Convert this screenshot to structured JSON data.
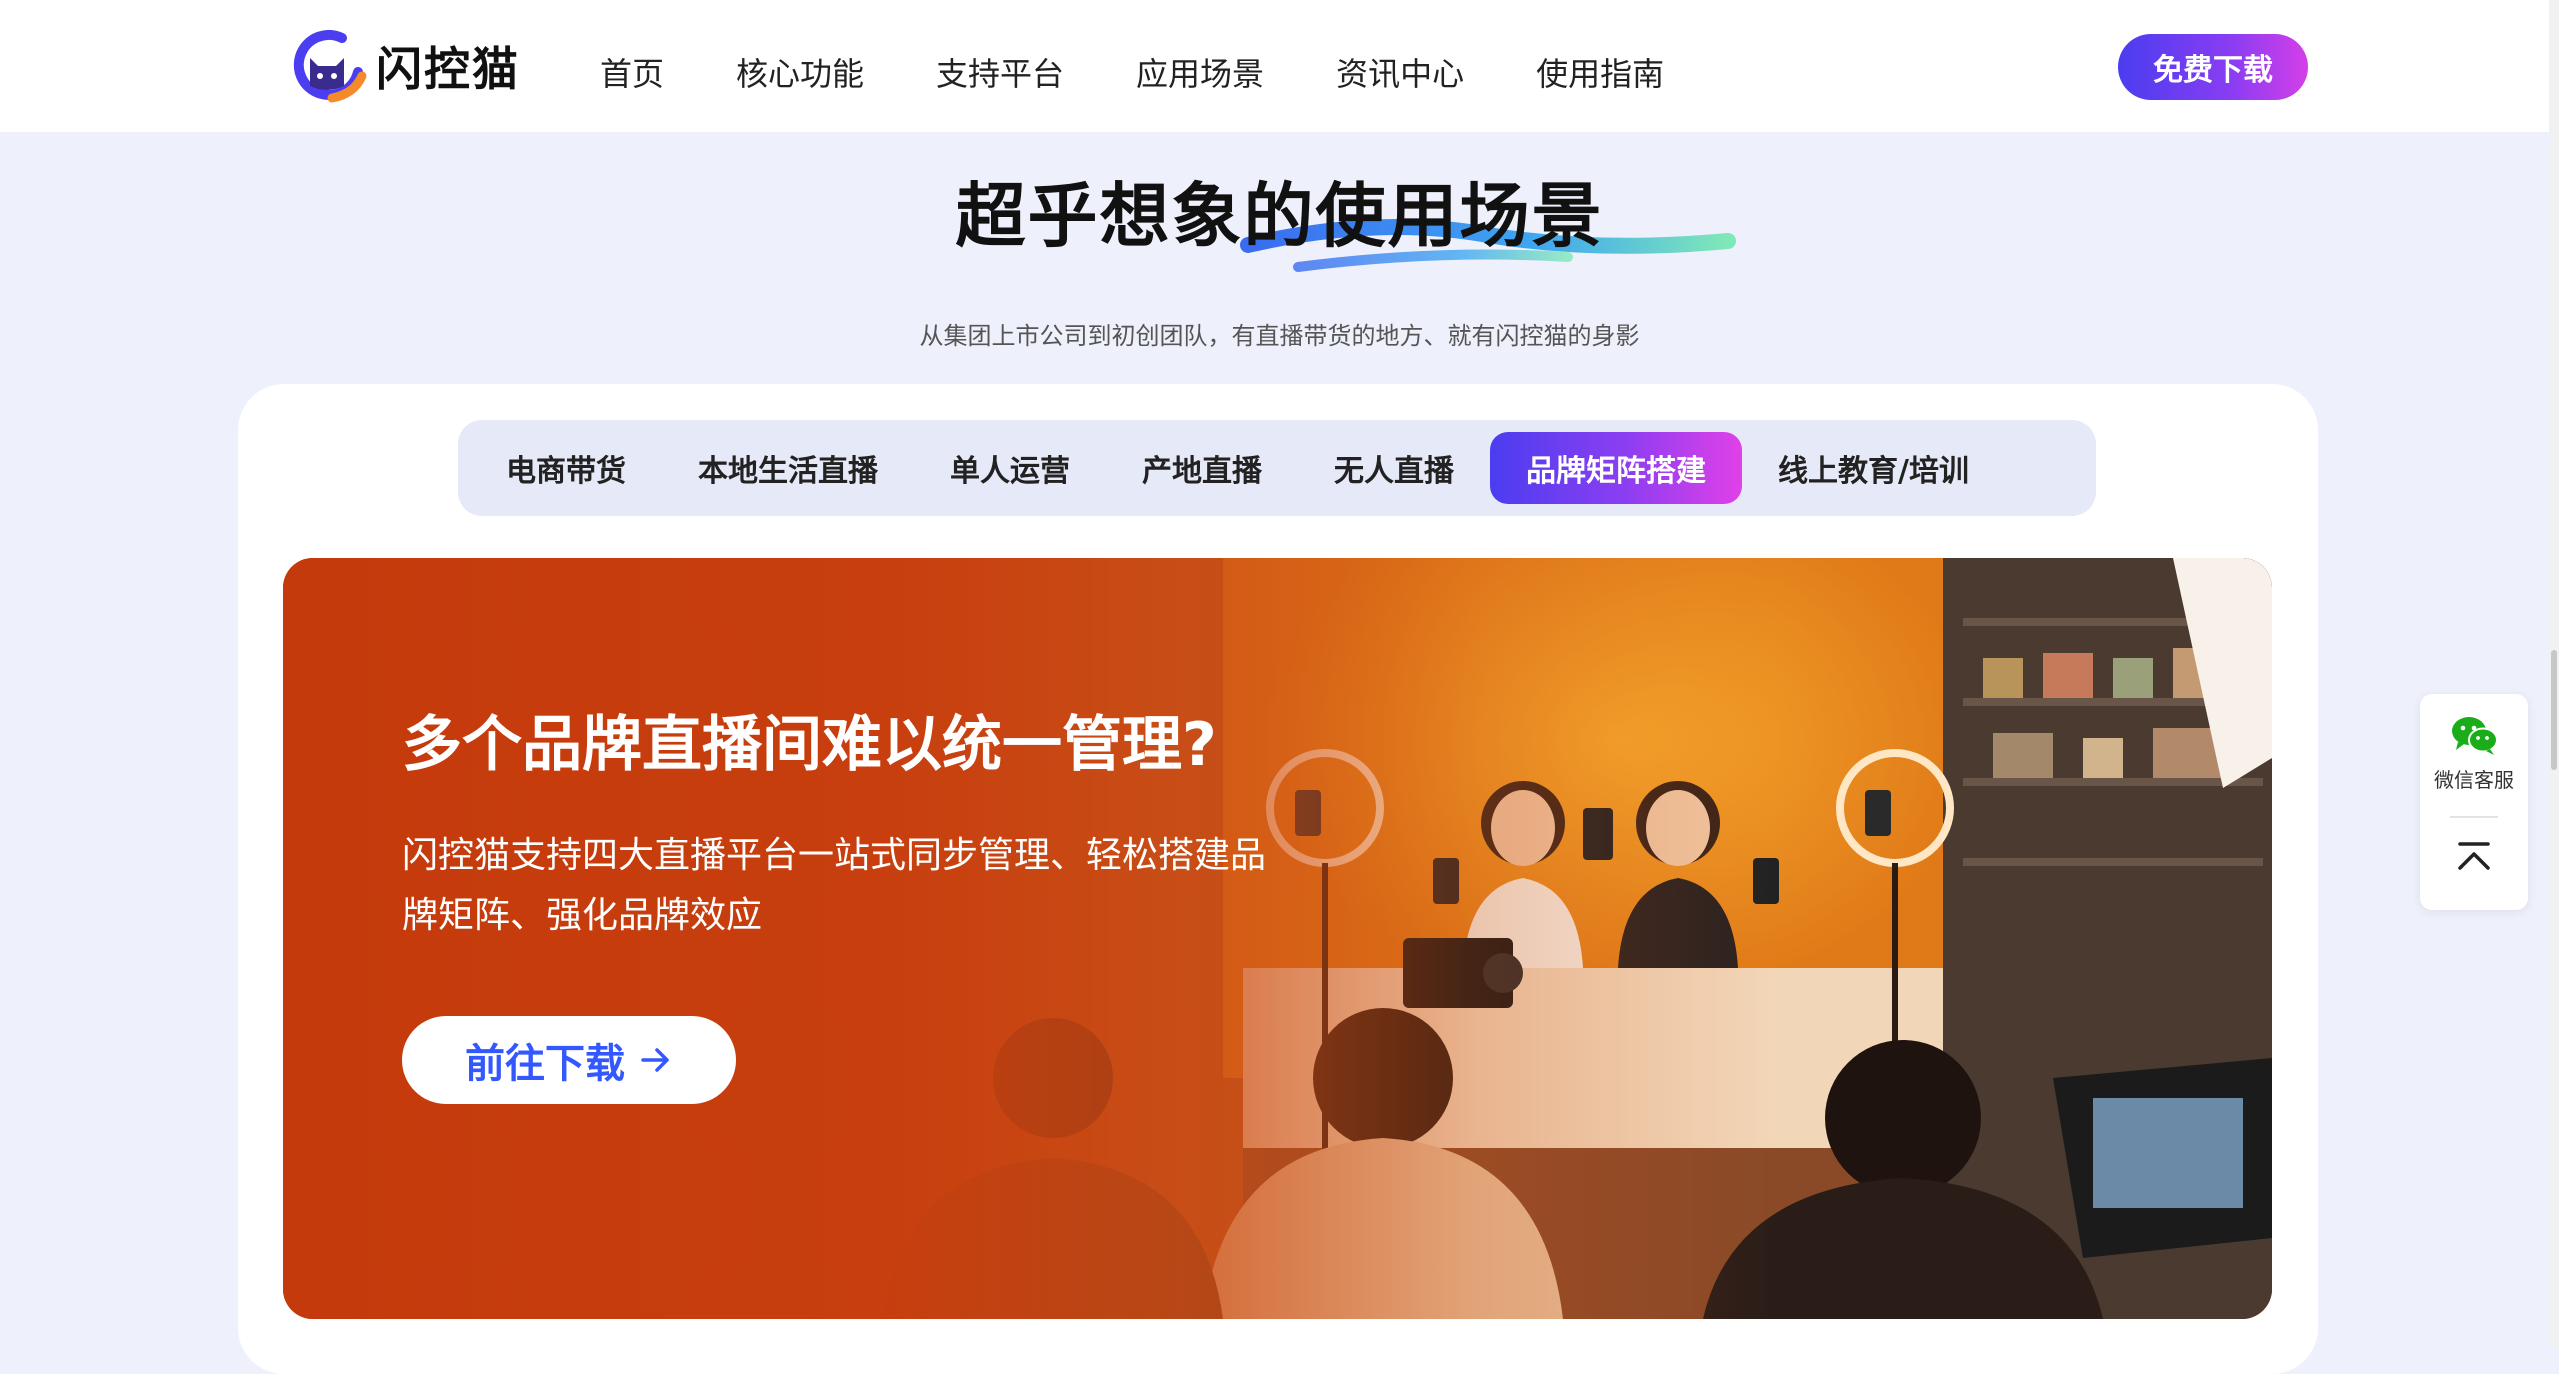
{
  "header": {
    "logo_text": "闪控猫",
    "nav": [
      "首页",
      "核心功能",
      "支持平台",
      "应用场景",
      "资讯中心",
      "使用指南"
    ],
    "download_label": "免费下载"
  },
  "section": {
    "title": "超乎想象的使用场景",
    "subtitle": "从集团上市公司到初创团队，有直播带货的地方、就有闪控猫的身影"
  },
  "tabs": [
    {
      "label": "电商带货",
      "active": false
    },
    {
      "label": "本地生活直播",
      "active": false
    },
    {
      "label": "单人运营",
      "active": false
    },
    {
      "label": "产地直播",
      "active": false
    },
    {
      "label": "无人直播",
      "active": false
    },
    {
      "label": "品牌矩阵搭建",
      "active": true
    },
    {
      "label": "线上教育/培训",
      "active": false
    }
  ],
  "banner": {
    "headline": "多个品牌直播间难以统一管理?",
    "description": "闪控猫支持四大直播平台一站式同步管理、轻松搭建品牌矩阵、强化品牌效应",
    "cta_label": "前往下载"
  },
  "float_panel": {
    "wechat_label": "微信客服"
  },
  "colors": {
    "accent_gradient_start": "#4b3df0",
    "accent_gradient_end": "#e040e8",
    "banner_orange": "#c3420e",
    "cta_text": "#3358ff",
    "wechat_green": "#1aad19"
  },
  "icons": [
    "logo-cat-icon",
    "arrow-right-icon",
    "wechat-icon",
    "back-to-top-icon"
  ]
}
